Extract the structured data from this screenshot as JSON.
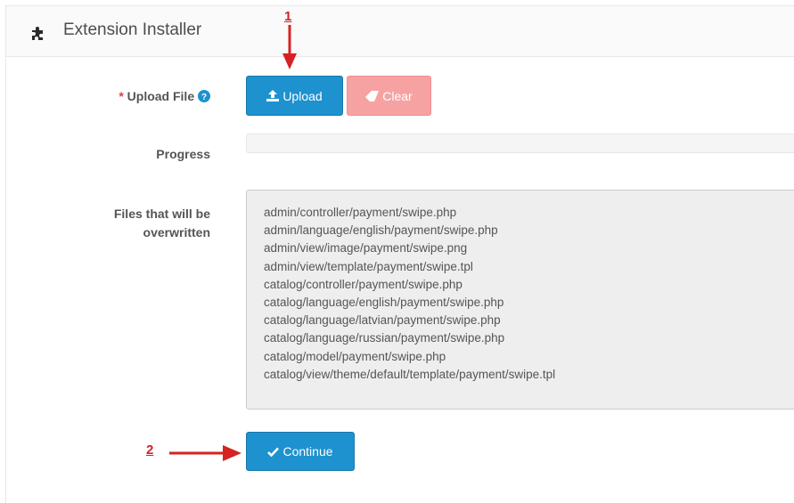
{
  "panel": {
    "title": "Extension Installer"
  },
  "upload": {
    "required_mark": "*",
    "label": "Upload File",
    "upload_button": "Upload",
    "clear_button": "Clear"
  },
  "progress": {
    "label": "Progress",
    "percent": 0
  },
  "files": {
    "label_line1": "Files that will be",
    "label_line2": "overwritten",
    "items": [
      "admin/controller/payment/swipe.php",
      "admin/language/english/payment/swipe.php",
      "admin/view/image/payment/swipe.png",
      "admin/view/template/payment/swipe.tpl",
      "catalog/controller/payment/swipe.php",
      "catalog/language/english/payment/swipe.php",
      "catalog/language/latvian/payment/swipe.php",
      "catalog/language/russian/payment/swipe.php",
      "catalog/model/payment/swipe.php",
      "catalog/view/theme/default/template/payment/swipe.tpl"
    ]
  },
  "continue_button": "Continue",
  "annotations": {
    "step1": "1",
    "step2": "2"
  },
  "icons": {
    "panel": "puzzle-icon",
    "help": "question-circle-icon",
    "upload": "upload-icon",
    "clear": "eraser-icon",
    "continue": "checkmark-icon"
  },
  "colors": {
    "primary": "#1e91cf",
    "danger_light": "#f7a2a2",
    "annotation": "#d62222"
  }
}
